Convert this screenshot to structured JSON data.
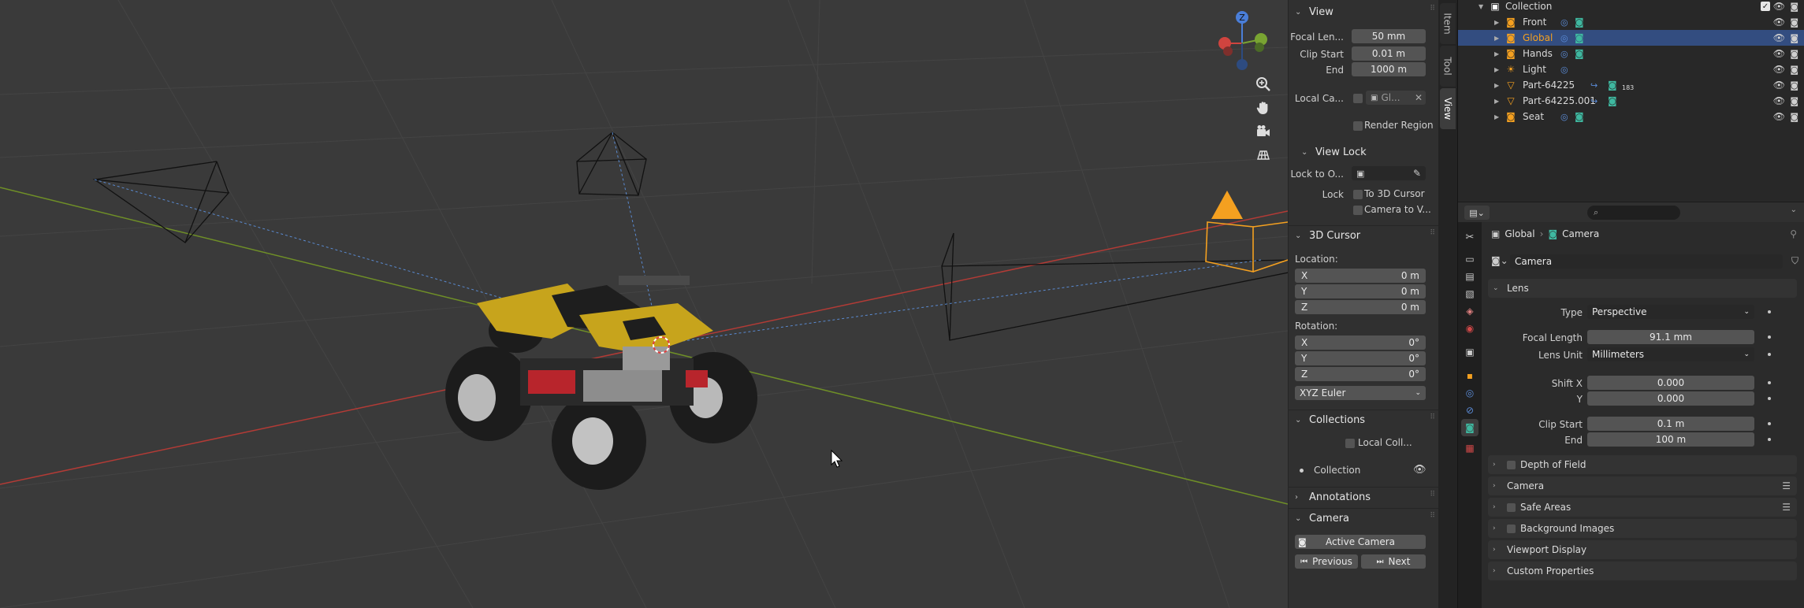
{
  "viewport": {
    "toolbar_icons": [
      "zoom-icon",
      "hand-pan-icon",
      "camera-view-icon",
      "grid-view-icon"
    ],
    "gizmo": {
      "z_label": "Z"
    }
  },
  "npanel": {
    "tabs": [
      "Item",
      "Tool",
      "View"
    ],
    "active_tab": "View",
    "view": {
      "header": "View",
      "focal_length_label": "Focal Len...",
      "focal_length_value": "50 mm",
      "clip_start_label": "Clip Start",
      "clip_start_value": "0.01 m",
      "end_label": "End",
      "end_value": "1000 m",
      "local_camera_label": "Local Ca...",
      "local_camera_value": "Gl...",
      "render_region_label": "Render Region"
    },
    "view_lock": {
      "header": "View Lock",
      "lock_to_object_label": "Lock to O...",
      "lock_label": "Lock",
      "to_3d_cursor_label": "To 3D Cursor",
      "camera_to_view_label": "Camera to V..."
    },
    "cursor": {
      "header": "3D Cursor",
      "location_label": "Location:",
      "location": [
        {
          "axis": "X",
          "value": "0 m"
        },
        {
          "axis": "Y",
          "value": "0 m"
        },
        {
          "axis": "Z",
          "value": "0 m"
        }
      ],
      "rotation_label": "Rotation:",
      "rotation": [
        {
          "axis": "X",
          "value": "0°"
        },
        {
          "axis": "Y",
          "value": "0°"
        },
        {
          "axis": "Z",
          "value": "0°"
        }
      ],
      "rotation_mode": "XYZ Euler"
    },
    "collections": {
      "header": "Collections",
      "local_collections_label": "Local Coll...",
      "item_label": "Collection"
    },
    "annotations": {
      "header": "Annotations"
    },
    "camera": {
      "header": "Camera",
      "active_camera_label": "Active Camera",
      "previous_label": "Previous",
      "next_label": "Next"
    }
  },
  "outliner": {
    "root": "Collection",
    "items": [
      {
        "name": "Front",
        "type": "camera"
      },
      {
        "name": "Global",
        "type": "camera",
        "selected": true
      },
      {
        "name": "Hands",
        "type": "camera"
      },
      {
        "name": "Light",
        "type": "light"
      },
      {
        "name": "Part-64225",
        "type": "mesh",
        "badge": "183"
      },
      {
        "name": "Part-64225.001",
        "type": "mesh"
      },
      {
        "name": "Seat",
        "type": "camera"
      }
    ]
  },
  "properties": {
    "breadcrumb_object": "Global",
    "breadcrumb_data": "Camera",
    "datablock_name": "Camera",
    "lens": {
      "header": "Lens",
      "type_label": "Type",
      "type_value": "Perspective",
      "focal_length_label": "Focal Length",
      "focal_length_value": "91.1 mm",
      "lens_unit_label": "Lens Unit",
      "lens_unit_value": "Millimeters",
      "shift_x_label": "Shift X",
      "shift_x_value": "0.000",
      "shift_y_label": "Y",
      "shift_y_value": "0.000",
      "clip_start_label": "Clip Start",
      "clip_start_value": "0.1 m",
      "clip_end_label": "End",
      "clip_end_value": "100 m"
    },
    "sections": [
      "Depth of Field",
      "Camera",
      "Safe Areas",
      "Background Images",
      "Viewport Display",
      "Custom Properties"
    ]
  },
  "colors": {
    "selection_row": "#334d80",
    "accent_orange": "#f4a020",
    "camera_teal": "#3fb8a0",
    "axis_red": "#c0413b",
    "axis_green": "#7a9a2a"
  }
}
